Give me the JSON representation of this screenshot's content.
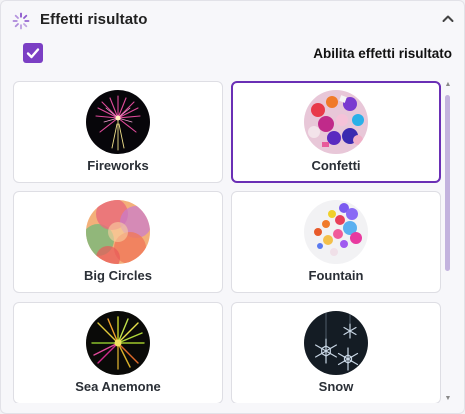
{
  "header": {
    "title": "Effetti risultato",
    "icon": "loading-spinner-icon",
    "collapse_icon": "chevron-up-icon"
  },
  "enable": {
    "label": "Abilita effetti risultato",
    "checked": true
  },
  "accent_color": "#7b3fc4",
  "effects": [
    {
      "label": "Fireworks",
      "selected": false,
      "icon": "fireworks-thumbnail"
    },
    {
      "label": "Confetti",
      "selected": true,
      "icon": "confetti-thumbnail"
    },
    {
      "label": "Big Circles",
      "selected": false,
      "icon": "big-circles-thumbnail"
    },
    {
      "label": "Fountain",
      "selected": false,
      "icon": "fountain-thumbnail"
    },
    {
      "label": "Sea Anemone",
      "selected": false,
      "icon": "sea-anemone-thumbnail"
    },
    {
      "label": "Snow",
      "selected": false,
      "icon": "snow-thumbnail"
    }
  ]
}
